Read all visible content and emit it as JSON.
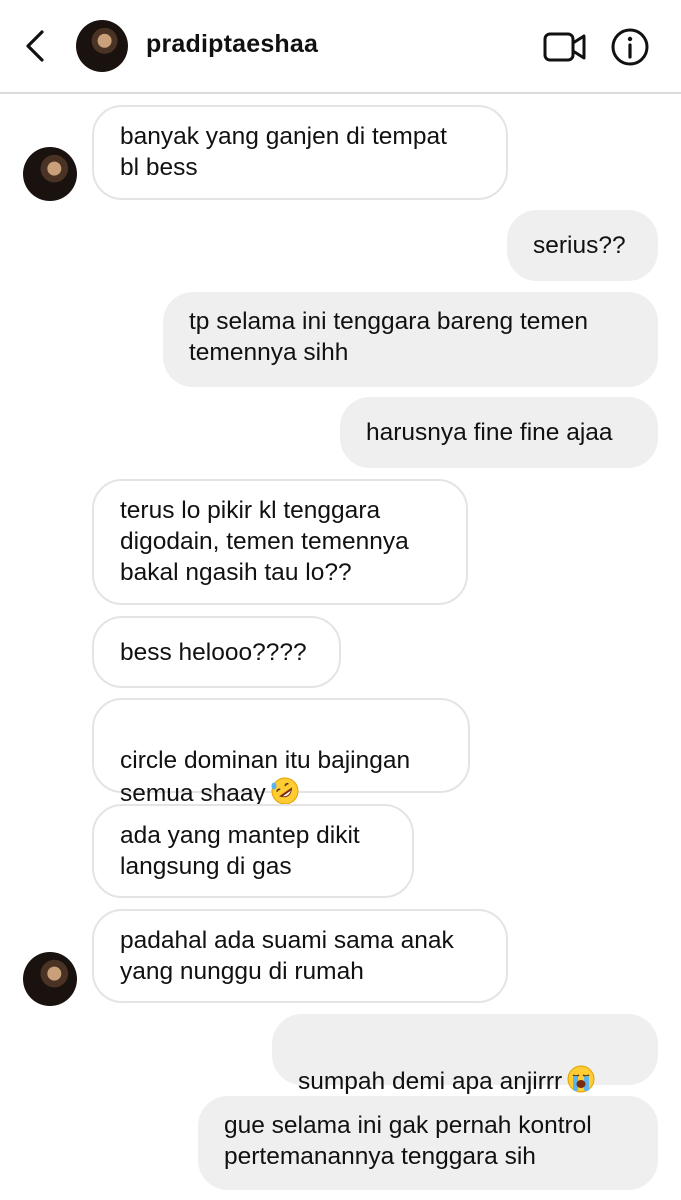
{
  "header": {
    "username": "pradiptaeshaa"
  },
  "icons": {
    "back": "chevron-left-icon",
    "video": "video-camera-icon",
    "info": "info-icon",
    "laugh_emoji": "rolling-on-floor-laughing-emoji",
    "cry_emoji": "loudly-crying-face-emoji"
  },
  "colors": {
    "outgoing_bubble": "#efefef",
    "incoming_border": "#e4e4e4",
    "emoji_yellow": "#ffcc33"
  },
  "messages": [
    {
      "from": "them",
      "text": "banyak yang ganjen di tempat\nbl bess"
    },
    {
      "from": "me",
      "text": "serius??"
    },
    {
      "from": "me",
      "text": "tp selama ini tenggara bareng temen\ntemennya sihh"
    },
    {
      "from": "me",
      "text": "harusnya fine fine ajaa"
    },
    {
      "from": "them",
      "text": "terus lo pikir kl tenggara\ndigodain, temen temennya\nbakal ngasih tau lo??"
    },
    {
      "from": "them",
      "text": "bess helooo????"
    },
    {
      "from": "them",
      "text": "circle dominan itu bajingan\nsemua shaay"
    },
    {
      "from": "them",
      "text": "ada yang mantep dikit\nlangsung di gas"
    },
    {
      "from": "them",
      "text": "padahal ada suami sama anak\nyang nunggu di rumah"
    },
    {
      "from": "me",
      "text": "sumpah demi apa anjirrr"
    },
    {
      "from": "me",
      "text": "gue selama ini gak pernah kontrol\npertemanannya tenggara sih"
    }
  ]
}
